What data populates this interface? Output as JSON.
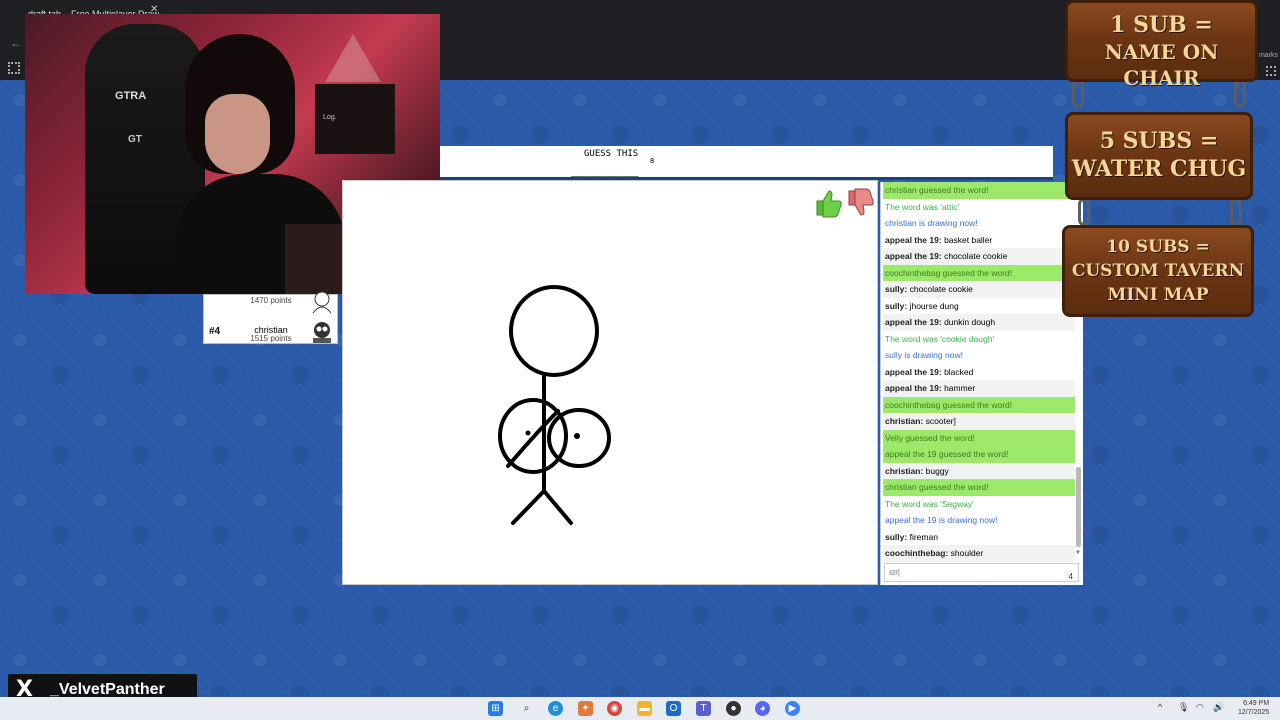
{
  "browser": {
    "tab_title": "draft tab – Free Multiplayer Draw",
    "right_text": "marks"
  },
  "webcam": {
    "chair_text": "GTRA",
    "chair_text2": "GT",
    "poster_text": "Log."
  },
  "game": {
    "guess_label": "GUESS THIS",
    "guess_count": "8",
    "word_blanks": "________"
  },
  "players": [
    {
      "rank": "",
      "name": "",
      "points": "1470 points"
    },
    {
      "rank": "#4",
      "name": "christian",
      "points": "1515 points"
    }
  ],
  "chat": {
    "messages": [
      {
        "style": "green",
        "user": "",
        "text": "christian guessed the word!"
      },
      {
        "style": "greentext",
        "user": "",
        "text": "The word was 'attic'"
      },
      {
        "style": "blue",
        "user": "",
        "text": "christian is drawing now!"
      },
      {
        "style": "even",
        "user": "appeal the 19:",
        "text": "basket baller"
      },
      {
        "style": "odd",
        "user": "appeal the 19:",
        "text": "chocolate cookie"
      },
      {
        "style": "green",
        "user": "",
        "text": "coochinthebag guessed the word!"
      },
      {
        "style": "odd",
        "user": "sully:",
        "text": "chocolate cookie"
      },
      {
        "style": "even",
        "user": "sully:",
        "text": "jhourse dung"
      },
      {
        "style": "odd",
        "user": "appeal the 19:",
        "text": "dunkin dough"
      },
      {
        "style": "greentext",
        "user": "",
        "text": "The word was 'cookie dough'"
      },
      {
        "style": "blue",
        "user": "",
        "text": "sully is drawing now!"
      },
      {
        "style": "even",
        "user": "appeal the 19:",
        "text": "blacked"
      },
      {
        "style": "odd",
        "user": "appeal the 19:",
        "text": "hammer"
      },
      {
        "style": "green",
        "user": "",
        "text": "coochinthebag guessed the word!"
      },
      {
        "style": "odd",
        "user": "christian:",
        "text": "scooter]"
      },
      {
        "style": "green",
        "user": "",
        "text": "Velly guessed the word!"
      },
      {
        "style": "green",
        "user": "",
        "text": "appeal the 19 guessed the word!"
      },
      {
        "style": "odd",
        "user": "christian:",
        "text": "buggy"
      },
      {
        "style": "green",
        "user": "",
        "text": "christian guessed the word!"
      },
      {
        "style": "greentext",
        "user": "",
        "text": "The word was 'Segway'"
      },
      {
        "style": "blue",
        "user": "",
        "text": "appeal the 19 is drawing now!"
      },
      {
        "style": "even",
        "user": "sully:",
        "text": "fireman"
      },
      {
        "style": "odd",
        "user": "coochinthebag:",
        "text": "shoulder"
      }
    ],
    "input_value": "str|",
    "input_count": "4"
  },
  "signs": [
    {
      "line1": "1 SUB =",
      "line2": "NAME ON CHAIR"
    },
    {
      "line1": "5 SUBS =",
      "line2": "WATER CHUG"
    },
    {
      "line1": "10 SUBS =",
      "line2": "CUSTOM TAVERN",
      "line3": "MINI MAP"
    }
  ],
  "handle": {
    "logo": "X",
    "name": "_VelvetPanther"
  },
  "taskbar": {
    "time": "6:49 PM",
    "date": "12/7/2025"
  },
  "colors": {
    "chat_green_bg": "#9be86a",
    "chat_blue_text": "#3b6fd3",
    "page_bg": "#2b5aa8",
    "sign_wood": "#6b3512"
  }
}
